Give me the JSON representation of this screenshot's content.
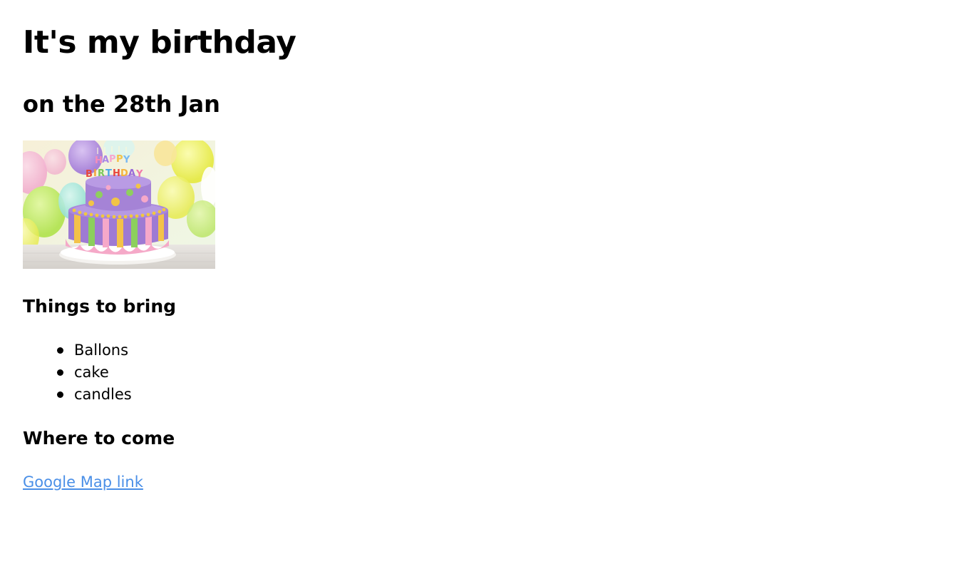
{
  "page": {
    "title": "It's my birthday",
    "subtitle": "on the 28th Jan"
  },
  "image": {
    "subject": "birthday-cake",
    "cake_topper_line1": "HAPPY",
    "cake_topper_line2": "BIRTHDAY"
  },
  "bring": {
    "heading": "Things to bring",
    "items": [
      "Ballons",
      "cake",
      "candles"
    ]
  },
  "where": {
    "heading": "Where to come",
    "link_text": "Google Map link"
  },
  "colors": {
    "text": "#000000",
    "link": "#4a8fe7",
    "background": "#ffffff"
  }
}
